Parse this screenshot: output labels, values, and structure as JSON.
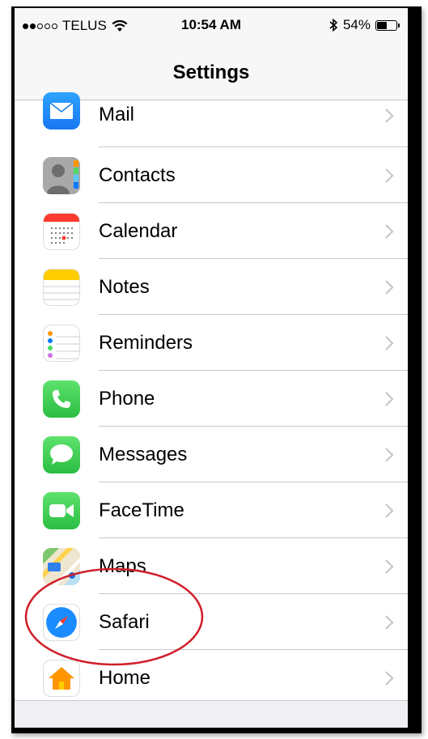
{
  "status_bar": {
    "carrier": "TELUS",
    "time": "10:54 AM",
    "battery_percent": "54%",
    "battery_level": 0.54,
    "signal_bars_filled": 2,
    "signal_bars_total": 5
  },
  "nav": {
    "title": "Settings"
  },
  "settings_items": [
    {
      "label": "Mail",
      "icon": "mail-icon"
    },
    {
      "label": "Contacts",
      "icon": "contacts-icon"
    },
    {
      "label": "Calendar",
      "icon": "calendar-icon"
    },
    {
      "label": "Notes",
      "icon": "notes-icon"
    },
    {
      "label": "Reminders",
      "icon": "reminders-icon"
    },
    {
      "label": "Phone",
      "icon": "phone-icon"
    },
    {
      "label": "Messages",
      "icon": "messages-icon"
    },
    {
      "label": "FaceTime",
      "icon": "facetime-icon"
    },
    {
      "label": "Maps",
      "icon": "maps-icon"
    },
    {
      "label": "Safari",
      "icon": "safari-icon"
    },
    {
      "label": "Home",
      "icon": "home-icon"
    }
  ],
  "colors": {
    "annotation_circle": "#d0202a",
    "phone_green": "#4cd964",
    "mail_blue": "#1e90ff",
    "safari_blue": "#1a8cff",
    "home_orange": "#ff9500",
    "separator": "#c8c7cc"
  }
}
